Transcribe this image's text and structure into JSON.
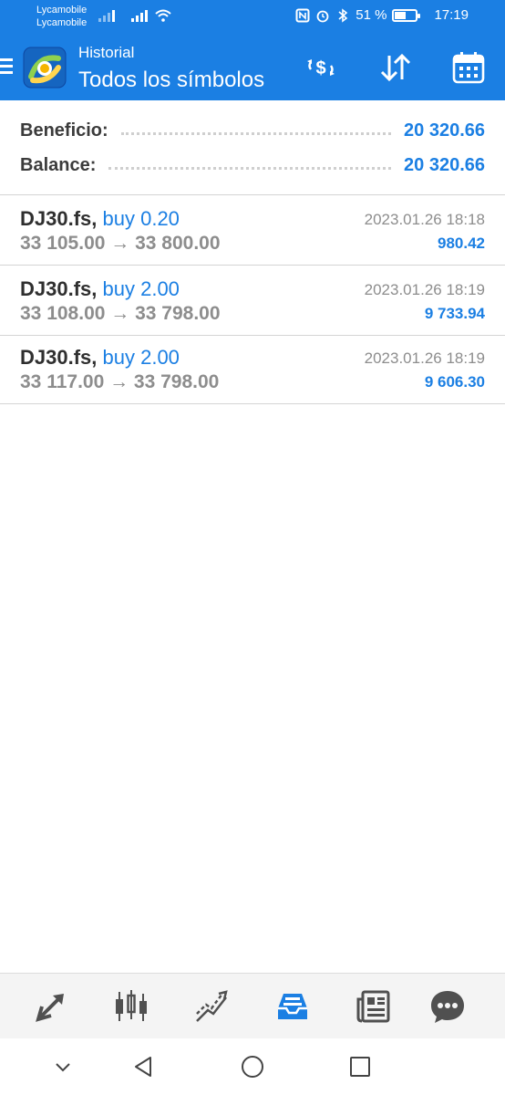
{
  "status_bar": {
    "carrier_1": "Lycamobile",
    "carrier_2": "Lycamobile",
    "battery": "51 %",
    "battery_level": 0.51,
    "time": "17:19"
  },
  "app_bar": {
    "subtitle": "Historial",
    "title": "Todos los símbolos",
    "actions": [
      "currency-swap-icon",
      "sort-icon",
      "calendar-icon"
    ]
  },
  "summary": {
    "profit_label": "Beneficio:",
    "profit_value": "20 320.66",
    "balance_label": "Balance:",
    "balance_value": "20 320.66"
  },
  "deals": [
    {
      "symbol": "DJ30.fs,",
      "type": "buy 0.20",
      "prices": "33 105.00 → 33 800.00",
      "time": "2023.01.26 18:18",
      "profit": "980.42"
    },
    {
      "symbol": "DJ30.fs,",
      "type": "buy 2.00",
      "prices": "33 108.00 → 33 798.00",
      "time": "2023.01.26 18:19",
      "profit": "9 733.94"
    },
    {
      "symbol": "DJ30.fs,",
      "type": "buy 2.00",
      "prices": "33 117.00 → 33 798.00",
      "time": "2023.01.26 18:19",
      "profit": "9 606.30"
    }
  ],
  "tab_bar": {
    "tabs": [
      "quotes-icon",
      "chart-icon",
      "trade-icon",
      "history-icon",
      "news-icon",
      "chat-icon"
    ],
    "active": "history-icon"
  },
  "colors": {
    "primary": "#1b7fe3",
    "text_dark": "#2f2f2f",
    "text_gray": "#8d8d8d",
    "tab_inactive": "#505050"
  }
}
